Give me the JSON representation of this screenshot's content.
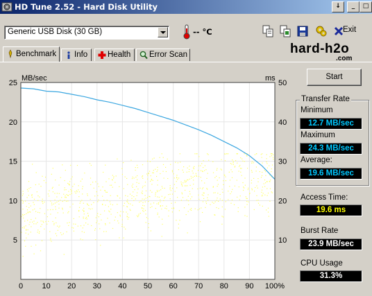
{
  "window": {
    "title": "HD Tune 2.52 - Hard Disk Utility",
    "caption_buttons": [
      "↓",
      "_",
      "□"
    ]
  },
  "toolbar": {
    "drive_selected": "Generic USB Disk (30 GB)",
    "temperature": "-- °C",
    "exit_label": "Exit",
    "exit_mnemonic": "x"
  },
  "tabs": [
    {
      "label": "Benchmark",
      "icon": "benchmark-icon",
      "active": true
    },
    {
      "label": "Info",
      "icon": "info-icon"
    },
    {
      "label": "Health",
      "icon": "health-icon"
    },
    {
      "label": "Error Scan",
      "icon": "error-scan-icon"
    }
  ],
  "brand": {
    "name": "hard-h2o",
    "suffix": ".com"
  },
  "side": {
    "start_label": "Start",
    "transfer_rate_label": "Transfer Rate",
    "minimum_label": "Minimum",
    "minimum_value": "12.7 MB/sec",
    "maximum_label": "Maximum",
    "maximum_value": "24.3 MB/sec",
    "average_label": "Average:",
    "average_value": "19.6 MB/sec",
    "access_label": "Access Time:",
    "access_value": "19.6 ms",
    "burst_label": "Burst Rate",
    "burst_value": "23.9 MB/sec",
    "cpu_label": "CPU Usage",
    "cpu_value": "31.3%"
  },
  "colors": {
    "title_start": "#0a246a",
    "title_end": "#a6caf0",
    "transfer_line": "#3aa6e0",
    "access_dots": "#ffff60",
    "value_cyan": "#00c8ff",
    "value_yellow": "#ffff00"
  },
  "chart_data": {
    "type": "line",
    "title": "",
    "y_left_label": "MB/sec",
    "y_right_label": "ms",
    "xlim": [
      0,
      100
    ],
    "ylim_left": [
      0,
      25
    ],
    "ylim_right": [
      0,
      50
    ],
    "x_ticks": [
      "0",
      "10",
      "20",
      "30",
      "40",
      "50",
      "60",
      "70",
      "80",
      "90",
      "100%"
    ],
    "y_left_ticks": [
      "5",
      "10",
      "15",
      "20",
      "25"
    ],
    "y_right_ticks": [
      "10",
      "20",
      "30",
      "40",
      "50"
    ],
    "series": [
      {
        "kind": "line",
        "axis": "left",
        "x": [
          0,
          5,
          10,
          15,
          20,
          25,
          30,
          35,
          40,
          45,
          50,
          55,
          60,
          65,
          70,
          75,
          80,
          85,
          90,
          95,
          100
        ],
        "values": [
          24.3,
          24.2,
          23.9,
          23.8,
          23.5,
          23.2,
          22.8,
          22.5,
          22.1,
          21.7,
          21.2,
          20.7,
          20.2,
          19.6,
          19.0,
          18.3,
          17.5,
          16.7,
          15.7,
          14.4,
          12.7
        ]
      },
      {
        "kind": "scatter",
        "axis": "right",
        "x_range": [
          0,
          100
        ],
        "y_range_ms": [
          5,
          32
        ],
        "center_ms_at_start": 17,
        "center_ms_at_end": 27,
        "count": 900
      }
    ]
  }
}
